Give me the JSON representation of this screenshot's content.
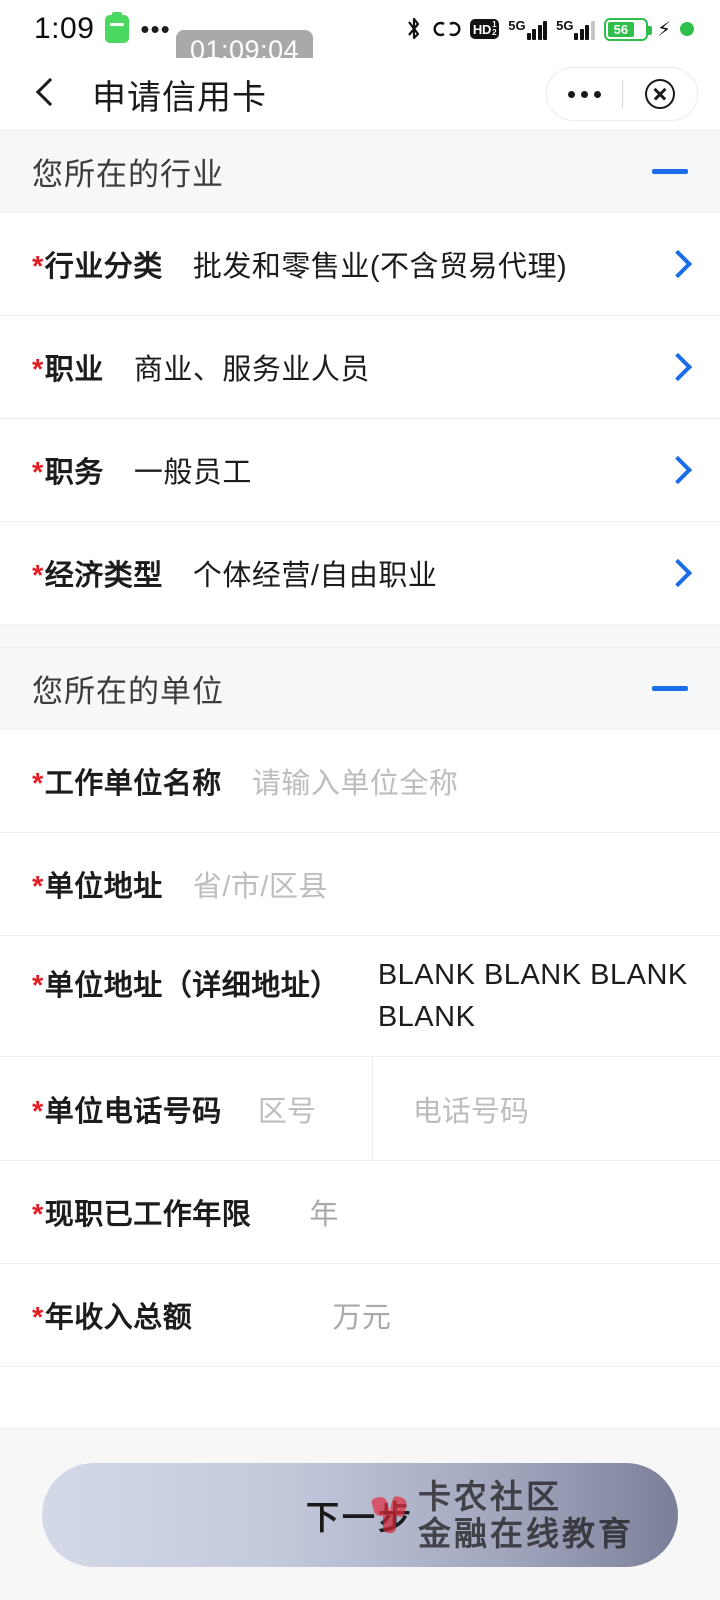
{
  "status_bar": {
    "time": "1:09",
    "icons": [
      "capsule-icon",
      "more-dots-icon",
      "bluetooth-icon",
      "link-icon",
      "hd-volte-icon",
      "signal-5g-1-icon",
      "signal-5g-2-icon",
      "battery-icon",
      "charging-bolt-icon",
      "green-dot-icon"
    ],
    "dots": "•••",
    "bluetooth": "ᛗ",
    "hd_label": "HD",
    "hd_sup": "1",
    "hd_sub": "2",
    "net_label_1": "5G",
    "net_label_2": "5G",
    "battery_percent": "56",
    "bolt": "⚡"
  },
  "timer_overlay": {
    "text": "01:09:04"
  },
  "nav": {
    "title": "申请信用卡",
    "back_icon": "back-chevron-icon",
    "more_icon": "more-dots-icon",
    "close_icon": "close-circle-icon"
  },
  "colors": {
    "accent_blue": "#1a6ce8",
    "required_red": "#e31e24",
    "section_bg": "#f6f7f8",
    "placeholder": "#bdbdbd"
  },
  "sections": [
    {
      "title": "您所在的行业",
      "collapse_icon": "minus-icon",
      "rows": [
        {
          "label": "行业分类",
          "required": "*",
          "value": "批发和零售业(不含贸易代理)",
          "type": "select"
        },
        {
          "label": "职业",
          "required": "*",
          "value": "商业、服务业人员",
          "type": "select"
        },
        {
          "label": "职务",
          "required": "*",
          "value": "一般员工",
          "type": "select"
        },
        {
          "label": "经济类型",
          "required": "*",
          "value": "个体经营/自由职业",
          "type": "select"
        }
      ]
    },
    {
      "title": "您所在的单位",
      "collapse_icon": "minus-icon",
      "rows": [
        {
          "label": "工作单位名称",
          "required": "*",
          "value": "",
          "placeholder": "请输入单位全称",
          "type": "input"
        },
        {
          "label": "单位地址",
          "required": "*",
          "value": "",
          "placeholder": "省/市/区县",
          "type": "picker"
        },
        {
          "label": "单位地址（详细地址）",
          "required": "*",
          "value": "BLANK BLANK BLANK BLANK",
          "type": "input"
        },
        {
          "label": "单位电话号码",
          "required": "*",
          "placeholder_area": "区号",
          "placeholder_number": "电话号码",
          "type": "phone"
        },
        {
          "label": "现职已工作年限",
          "required": "*",
          "value": "",
          "placeholder": "年",
          "type": "input"
        },
        {
          "label": "年收入总额",
          "required": "*",
          "value": "",
          "placeholder": "万元",
          "type": "input"
        }
      ]
    }
  ],
  "footer": {
    "next_label": "下一步",
    "watermark_main": "卡农社区",
    "watermark_sub": "金融在线教育",
    "watermark_logo": "flower-logo-icon"
  }
}
